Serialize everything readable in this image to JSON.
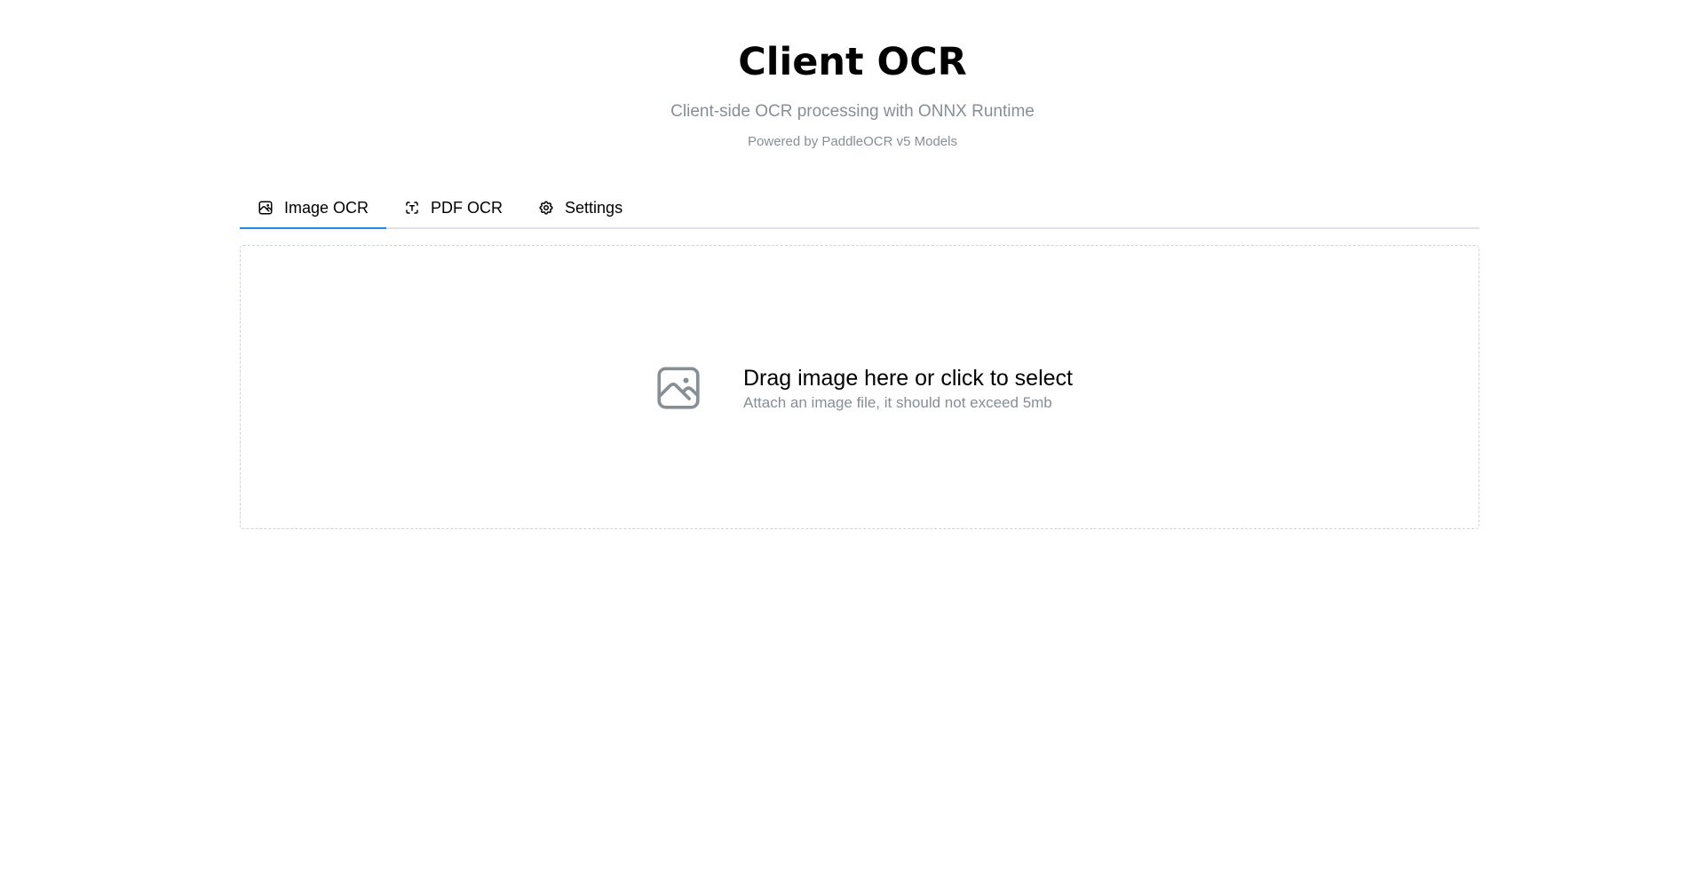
{
  "header": {
    "title": "Client OCR",
    "subtitle": "Client-side OCR processing with ONNX Runtime",
    "powered_by": "Powered by PaddleOCR v5 Models"
  },
  "tabs": [
    {
      "label": "Image OCR",
      "icon": "photo-icon",
      "active": true
    },
    {
      "label": "PDF OCR",
      "icon": "scan-icon",
      "active": false
    },
    {
      "label": "Settings",
      "icon": "gear-icon",
      "active": false
    }
  ],
  "dropzone": {
    "icon": "photo-icon",
    "title": "Drag image here or click to select",
    "hint": "Attach an image file, it should not exceed 5mb"
  },
  "colors": {
    "accent": "#228be6",
    "muted_text": "#868e96",
    "border": "#dee2e6"
  }
}
